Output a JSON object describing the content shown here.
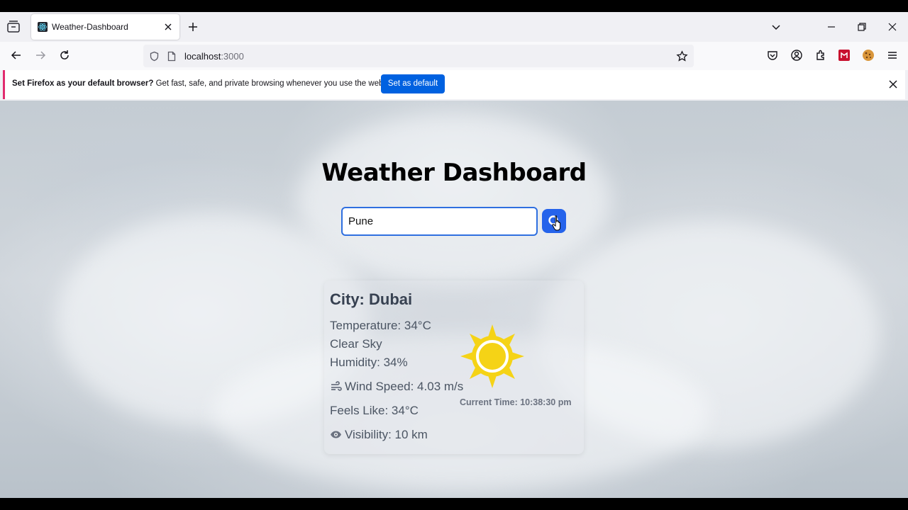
{
  "browser": {
    "tab": {
      "title": "Weather-Dashboard"
    },
    "url": {
      "host": "localhost",
      "port": ":3000"
    },
    "notification": {
      "bold": "Set Firefox as your default browser?",
      "text": " Get fast, safe, and private browsing whenever you use the web.",
      "button": "Set as default"
    }
  },
  "app": {
    "title": "Weather Dashboard",
    "search": {
      "value": "Pune"
    },
    "weather": {
      "city": "City: Dubai",
      "temperature": "Temperature: 34°C",
      "condition": "Clear Sky",
      "humidity": "Humidity: 34%",
      "wind": "Wind Speed: 4.03 m/s",
      "feels_like": "Feels Like: 34°C",
      "visibility": "Visibility: 10 km",
      "current_time": "Current Time: 10:38:30 pm",
      "icon": "sun-icon"
    }
  },
  "colors": {
    "accent": "#2563eb",
    "sun": "#f5d316",
    "firefox_button": "#0061e0"
  }
}
